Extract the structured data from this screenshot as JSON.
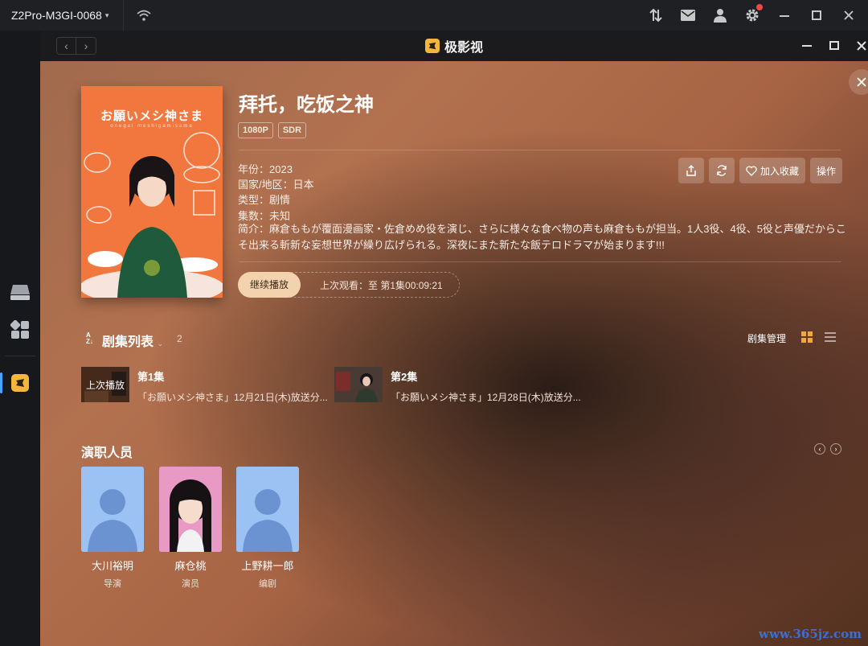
{
  "topbar": {
    "device_name": "Z2Pro-M3GI-0068",
    "icons": [
      "wifi-icon",
      "transfer-icon",
      "mail-icon",
      "user-icon",
      "settings-icon",
      "minimize-icon",
      "maximize-icon",
      "close-icon"
    ]
  },
  "dock": {
    "items": [
      "drive-icon",
      "apps-icon",
      "app-logo-icon"
    ]
  },
  "window": {
    "app_name": "极影视"
  },
  "detail": {
    "poster_title": "お願いメシ神さま",
    "poster_subtitle": "onegai meshigamisama",
    "title": "拜托，吃饭之神",
    "badges": [
      "1080P",
      "SDR"
    ],
    "year": "年份：2023",
    "region": "国家/地区：日本",
    "genre": "类型：剧情",
    "episodes": "集数：未知",
    "description": "简介：麻倉ももが覆面漫画家・佐倉めめ役を演じ、さらに様々な食べ物の声も麻倉ももが担当。1人3役、4役、5役と声優だからこそ出来る斬新な妄想世界が繰り広げられる。深夜にまた新たな飯テロドラマが始まります!!!",
    "actions": {
      "favorite": "加入收藏",
      "operate": "操作"
    },
    "resume_label": "继续播放",
    "last_watched": "上次观看：至 第1集00:09:21"
  },
  "episode_list": {
    "title": "剧集列表",
    "count": "2",
    "manage": "剧集管理",
    "items": [
      {
        "name": "第1集",
        "desc": "「お願いメシ神さま」12月21日(木)放送分...",
        "thumb_label": "上次播放"
      },
      {
        "name": "第2集",
        "desc": "「お願いメシ神さま」12月28日(木)放送分..."
      }
    ]
  },
  "cast": {
    "title": "演职人员",
    "members": [
      {
        "name": "大川裕明",
        "role": "导演"
      },
      {
        "name": "麻仓桃",
        "role": "演员"
      },
      {
        "name": "上野耕一郎",
        "role": "编剧"
      }
    ]
  },
  "watermark": "www.365jz.com",
  "colors": {
    "accent": "#f2a93b",
    "resume_bg": "#f2d3ad",
    "logo": "#f5b73b"
  }
}
